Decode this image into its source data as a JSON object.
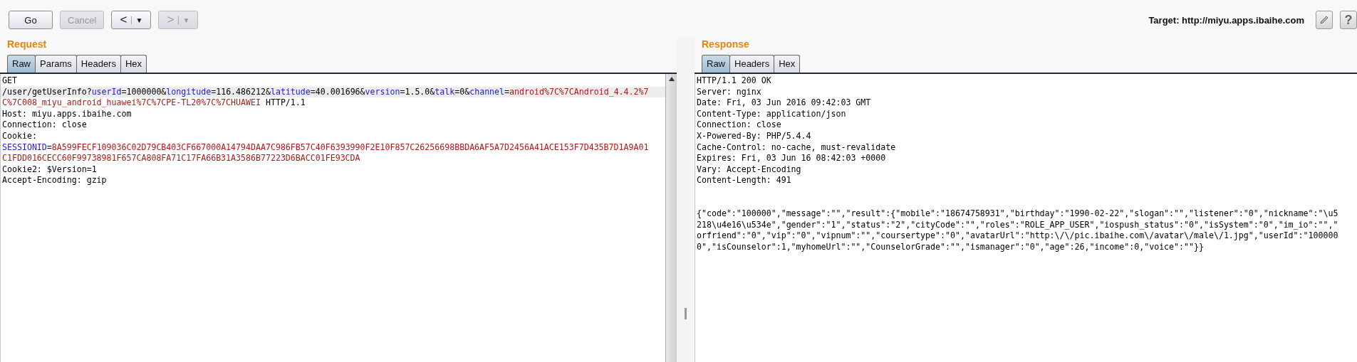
{
  "toolbar": {
    "buttons": [
      {
        "kind": "text",
        "label": "Go",
        "disabled": false
      },
      {
        "kind": "text",
        "label": "Cancel",
        "disabled": true
      },
      {
        "kind": "split",
        "label": "<",
        "caret": "▼",
        "disabled": false
      },
      {
        "kind": "split",
        "label": ">",
        "caret": "▼",
        "disabled": true
      }
    ],
    "target": "Target: http://miyu.apps.ibaihe.com",
    "help_label": "?"
  },
  "request": {
    "title": "Request",
    "tabs": [
      {
        "label": "Raw",
        "selected": true
      },
      {
        "label": "Params",
        "selected": false
      },
      {
        "label": "Headers",
        "selected": false
      },
      {
        "label": "Hex",
        "selected": false
      }
    ],
    "lines": [
      {
        "current": false,
        "segments": [
          {
            "kind": "plain",
            "text": "GET"
          }
        ]
      },
      {
        "current": true,
        "segments": [
          {
            "kind": "plain",
            "text": "/user/getUserInfo?"
          },
          {
            "kind": "key",
            "text": "userId"
          },
          {
            "kind": "plain",
            "text": "=1000000&"
          },
          {
            "kind": "key",
            "text": "longitude"
          },
          {
            "kind": "plain",
            "text": "=116.486212&"
          },
          {
            "kind": "key",
            "text": "latitude"
          },
          {
            "kind": "plain",
            "text": "=40.001696&"
          },
          {
            "kind": "key",
            "text": "version"
          },
          {
            "kind": "plain",
            "text": "=1.5.0&"
          },
          {
            "kind": "key",
            "text": "talk"
          },
          {
            "kind": "plain",
            "text": "=0&"
          },
          {
            "kind": "key",
            "text": "channel"
          },
          {
            "kind": "plain",
            "text": "="
          },
          {
            "kind": "value",
            "text": "android%7C%7CAndroid_4.4.2%7"
          }
        ]
      },
      {
        "current": false,
        "segments": [
          {
            "kind": "value",
            "text": "C%7C008_miyu_android_huawei%7C%7CPE-TL20%7C%7CHUAWEI"
          },
          {
            "kind": "plain",
            "text": " HTTP/1.1"
          }
        ]
      },
      {
        "current": false,
        "segments": [
          {
            "kind": "plain",
            "text": "Host: miyu.apps.ibaihe.com"
          }
        ]
      },
      {
        "current": false,
        "segments": [
          {
            "kind": "plain",
            "text": "Connection: close"
          }
        ]
      },
      {
        "current": false,
        "segments": [
          {
            "kind": "plain",
            "text": "Cookie:"
          }
        ]
      },
      {
        "current": false,
        "segments": [
          {
            "kind": "key",
            "text": "SESSIONID"
          },
          {
            "kind": "plain",
            "text": "="
          },
          {
            "kind": "value",
            "text": "8A599FECF109036C02D79CB403CF667000A14794DAA7C986FB57C40F6393990F2E10F857C26256698BBDA6AF5A7D2456A41ACE153F7D435B7D1A9A01"
          }
        ]
      },
      {
        "current": false,
        "segments": [
          {
            "kind": "value",
            "text": "C1FDD016CECC60F99738981F657CA808FA71C17FA66B31A3586B77223D6BACC01FE93CDA"
          }
        ]
      },
      {
        "current": false,
        "segments": [
          {
            "kind": "plain",
            "text": "Cookie2: $Version=1"
          }
        ]
      },
      {
        "current": false,
        "segments": [
          {
            "kind": "plain",
            "text": "Accept-Encoding: gzip"
          }
        ]
      }
    ]
  },
  "response": {
    "title": "Response",
    "tabs": [
      {
        "label": "Raw",
        "selected": true
      },
      {
        "label": "Headers",
        "selected": false
      },
      {
        "label": "Hex",
        "selected": false
      }
    ],
    "header_lines": [
      "HTTP/1.1 200 OK",
      "Server: nginx",
      "Date: Fri, 03 Jun 2016 09:42:03 GMT",
      "Content-Type: application/json",
      "Connection: close",
      "X-Powered-By: PHP/5.4.4",
      "Cache-Control: no-cache, must-revalidate",
      "Expires: Fri, 03 Jun 16 08:42:03 +0000",
      "Vary: Accept-Encoding",
      "Content-Length: 491"
    ],
    "body_lines": [
      "{\"code\":\"100000\",\"message\":\"\",\"result\":{\"mobile\":\"18674758931\",\"birthday\":\"1990-02-22\",\"slogan\":\"\",\"listener\":\"0\",\"nickname\":\"\\u5",
      "218\\u4e16\\u534e\",\"gender\":\"1\",\"status\":\"2\",\"cityCode\":\"\",\"roles\":\"ROLE_APP_USER\",\"iospush_status\":\"0\",\"isSystem\":\"0\",\"im_io\":\"\",\"",
      "orfriend\":\"0\",\"vip\":\"0\",\"vipnum\":\"\",\"coursertype\":\"0\",\"avatarUrl\":\"http:\\/\\/pic.ibaihe.com\\/avatar\\/male\\/1.jpg\",\"userId\":\"100000",
      "0\",\"isCounselor\":1,\"myhomeUrl\":\"\",\"CounselorGrade\":\"\",\"ismanager\":\"0\",\"age\":26,\"income\":0,\"voice\":\"\"}}"
    ]
  }
}
